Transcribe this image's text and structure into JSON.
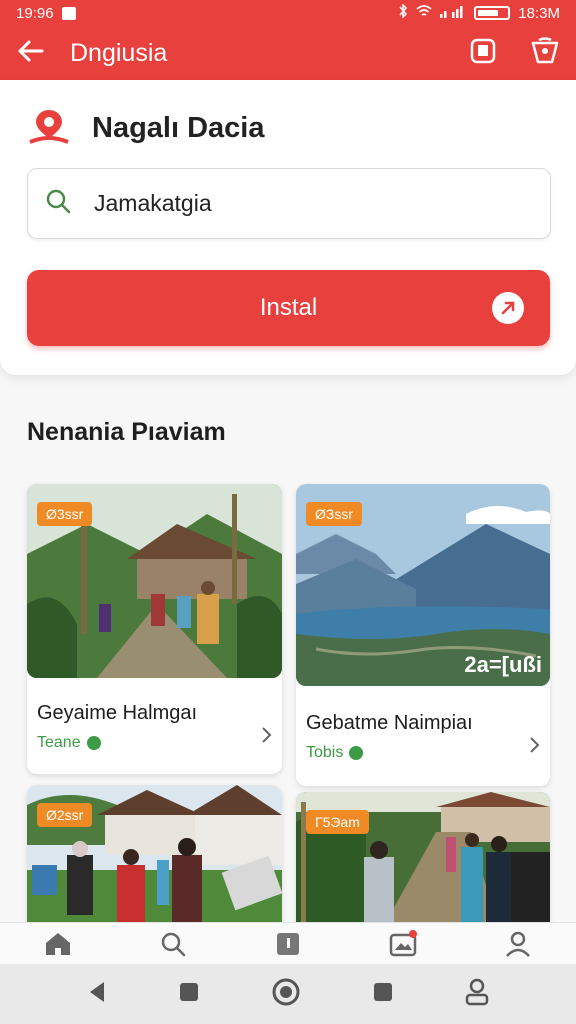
{
  "status_bar": {
    "time": "19:96",
    "right_time": "18:3M"
  },
  "app_bar": {
    "title": "Dngiusia"
  },
  "location": {
    "name": "Nagalı Dacia"
  },
  "search": {
    "value": "Jamakatgia"
  },
  "install_button": {
    "label": "Instal"
  },
  "section": {
    "title": "Nenania Pıaviam"
  },
  "tiles": [
    {
      "badge": "Ø3ssr",
      "name": "Geyaime Halmgaı",
      "meta": "Teane"
    },
    {
      "badge": "ØЗssr",
      "name": "Gebatme Naimpiaı",
      "meta": "Tobis",
      "caption": "2a=[ußi"
    },
    {
      "badge": "Ø2ssr"
    },
    {
      "badge": "Г5Эam"
    }
  ],
  "colors": {
    "brand_red": "#e8403c",
    "badge_orange": "#f08a24",
    "meta_green": "#3d9a45"
  }
}
